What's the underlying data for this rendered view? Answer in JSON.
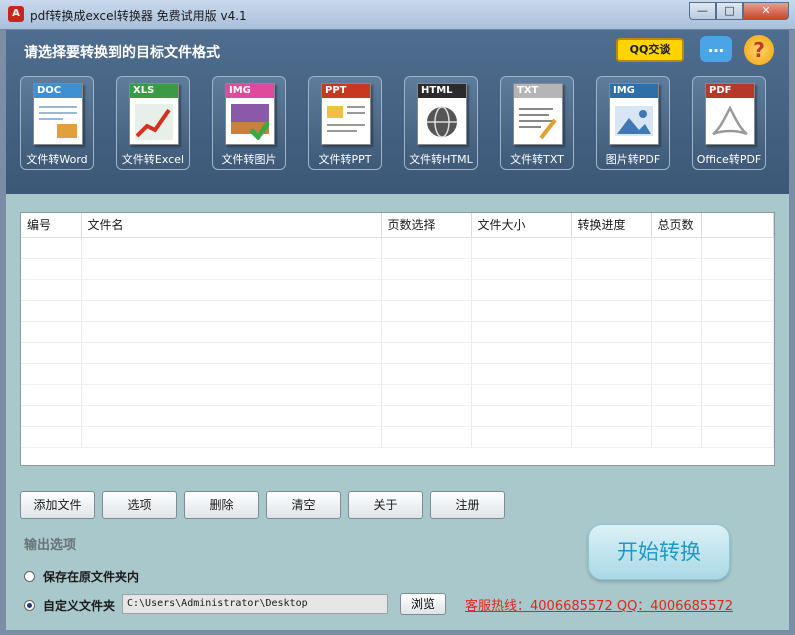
{
  "window": {
    "title": "pdf转换成excel转换器 免费试用版 v4.1",
    "minimize": "—",
    "maximize": "□",
    "close": "✕"
  },
  "header": {
    "prompt": "请选择要转换到的目标文件格式",
    "qq_label": "QQ交谈",
    "chat_icon": "speech-bubble-icon",
    "help_icon": "help-icon"
  },
  "tools": [
    {
      "badge": "DOC",
      "label": "文件转Word",
      "color": "#3f8fd2"
    },
    {
      "badge": "XLS",
      "label": "文件转Excel",
      "color": "#3a9a45"
    },
    {
      "badge": "IMG",
      "label": "文件转图片",
      "color": "#e04a9a"
    },
    {
      "badge": "PPT",
      "label": "文件转PPT",
      "color": "#c8371f"
    },
    {
      "badge": "HTML",
      "label": "文件转HTML",
      "color": "#2b2b2b"
    },
    {
      "badge": "TXT",
      "label": "文件转TXT",
      "color": "#b5b5b5"
    },
    {
      "badge": "IMG",
      "label": "图片转PDF",
      "color": "#2f6fa8"
    },
    {
      "badge": "PDF",
      "label": "Office转PDF",
      "color": "#b5382a"
    }
  ],
  "table": {
    "columns": [
      "编号",
      "文件名",
      "页数选择",
      "文件大小",
      "转换进度",
      "总页数"
    ]
  },
  "buttons": {
    "add": "添加文件",
    "options": "选项",
    "delete": "删除",
    "clear": "清空",
    "about": "关于",
    "register": "注册"
  },
  "output": {
    "title": "输出选项",
    "save_original": "保存在原文件夹内",
    "custom_folder": "自定义文件夹",
    "path": "C:\\Users\\Administrator\\Desktop",
    "browse": "浏览",
    "selected": "custom"
  },
  "start": "开始转换",
  "hotline": "客服热线：4006685572 QQ：4006685572"
}
